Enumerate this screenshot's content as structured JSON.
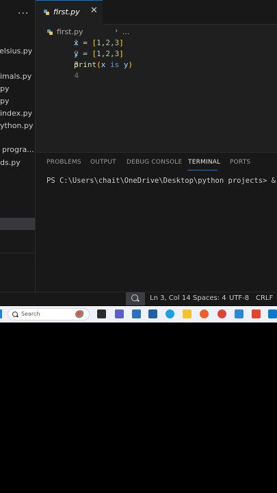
{
  "sidebar": {
    "more_label": "···",
    "files": [
      {
        "label": "elsius.py"
      },
      {
        "label": "imals.py"
      },
      {
        "label": "py"
      },
      {
        "label": "py"
      },
      {
        "label": "index.py"
      },
      {
        "label": "ython.py"
      },
      {
        "label": "progra..."
      },
      {
        "label": "ds.py"
      }
    ]
  },
  "tab": {
    "label": "first.py",
    "close": "✕"
  },
  "breadcrumb": {
    "file": "first.py",
    "separator": "›",
    "rest": "..."
  },
  "editor": {
    "lines": [
      {
        "number": "1",
        "tokens": [
          "x",
          "=",
          "[",
          "1,2,3",
          "]"
        ]
      },
      {
        "number": "2",
        "tokens": [
          "y",
          "=",
          "[",
          "1,2,3",
          "]"
        ]
      },
      {
        "number": "3",
        "tokens": [
          "print",
          "(",
          "x",
          "is",
          "y",
          ")"
        ]
      },
      {
        "number": "4",
        "tokens": []
      }
    ],
    "active_line": 3
  },
  "panel": {
    "tabs": [
      "PROBLEMS",
      "OUTPUT",
      "DEBUG CONSOLE",
      "TERMINAL",
      "PORTS"
    ],
    "active_tab": "TERMINAL",
    "terminal_prompt": "PS C:\\Users\\chait\\OneDrive\\Desktop\\python projects> ",
    "terminal_cmd": "& C:"
  },
  "statusbar": {
    "position": "Ln 3, Col 14",
    "spaces": "Spaces: 4",
    "encoding": "UTF-8",
    "eol": "CRLF"
  },
  "taskbar": {
    "search_label": "Search",
    "icons": [
      {
        "name": "task-view-icon",
        "color": "#2b2b2b"
      },
      {
        "name": "teams-icon",
        "color": "#5b5fc7"
      },
      {
        "name": "video-app-icon",
        "color": "#2f6fb5"
      },
      {
        "name": "store-icon",
        "color": "#1f5fa8"
      },
      {
        "name": "edge-icon",
        "color": "#1aa1e0"
      },
      {
        "name": "file-explorer-icon",
        "color": "#f2c230"
      },
      {
        "name": "firefox-icon",
        "color": "#e8612c"
      },
      {
        "name": "chrome-icon",
        "color": "#db4437"
      },
      {
        "name": "notepad-icon",
        "color": "#2b88d8"
      },
      {
        "name": "brave-icon",
        "color": "#e2442f"
      },
      {
        "name": "vscode-icon",
        "color": "#0a7ad1"
      }
    ]
  }
}
